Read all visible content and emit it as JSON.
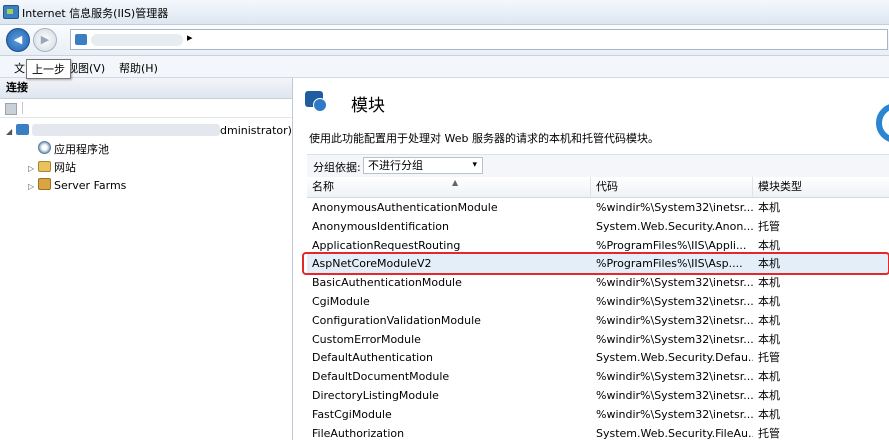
{
  "window": {
    "title": "Internet 信息服务(IIS)管理器"
  },
  "nav": {
    "back_glyph": "◀",
    "forward_glyph": "▶",
    "address_arrow": "▸"
  },
  "menu": {
    "file": "文",
    "view": "视图(V)",
    "help": "帮助(H)",
    "tooltip": "上一步"
  },
  "connections": {
    "header": "连接",
    "server_suffix": "dministrator)",
    "items": [
      {
        "label": "应用程序池",
        "icon": "app-pool-icon"
      },
      {
        "label": "网站",
        "icon": "sites-icon"
      },
      {
        "label": "Server Farms",
        "icon": "server-farms-icon"
      }
    ]
  },
  "main": {
    "title": "模块",
    "description": "使用此功能配置用于处理对 Web 服务器的请求的本机和托管代码模块。",
    "group_by_label": "分组依据:",
    "group_by_value": "不进行分组",
    "columns": [
      "名称",
      "代码",
      "模块类型"
    ]
  },
  "modules": [
    {
      "name": "AnonymousAuthenticationModule",
      "code": "%windir%\\System32\\inetsr...",
      "type": "本机"
    },
    {
      "name": "AnonymousIdentification",
      "code": "System.Web.Security.Anon...",
      "type": "托管"
    },
    {
      "name": "ApplicationRequestRouting",
      "code": "%ProgramFiles%\\IIS\\Appli...",
      "type": "本机"
    },
    {
      "name": "AspNetCoreModuleV2",
      "code": "%ProgramFiles%\\IIS\\Asp....",
      "type": "本机"
    },
    {
      "name": "BasicAuthenticationModule",
      "code": "%windir%\\System32\\inetsr...",
      "type": "本机"
    },
    {
      "name": "CgiModule",
      "code": "%windir%\\System32\\inetsr...",
      "type": "本机"
    },
    {
      "name": "ConfigurationValidationModule",
      "code": "%windir%\\System32\\inetsr...",
      "type": "本机"
    },
    {
      "name": "CustomErrorModule",
      "code": "%windir%\\System32\\inetsr...",
      "type": "本机"
    },
    {
      "name": "DefaultAuthentication",
      "code": "System.Web.Security.Defau...",
      "type": "托管"
    },
    {
      "name": "DefaultDocumentModule",
      "code": "%windir%\\System32\\inetsr...",
      "type": "本机"
    },
    {
      "name": "DirectoryListingModule",
      "code": "%windir%\\System32\\inetsr...",
      "type": "本机"
    },
    {
      "name": "FastCgiModule",
      "code": "%windir%\\System32\\inetsr...",
      "type": "本机"
    },
    {
      "name": "FileAuthorization",
      "code": "System.Web.Security.FileAu...",
      "type": "托管"
    }
  ],
  "colors": {
    "highlight": "#e3282b",
    "selected_row": "#e3eef9"
  }
}
